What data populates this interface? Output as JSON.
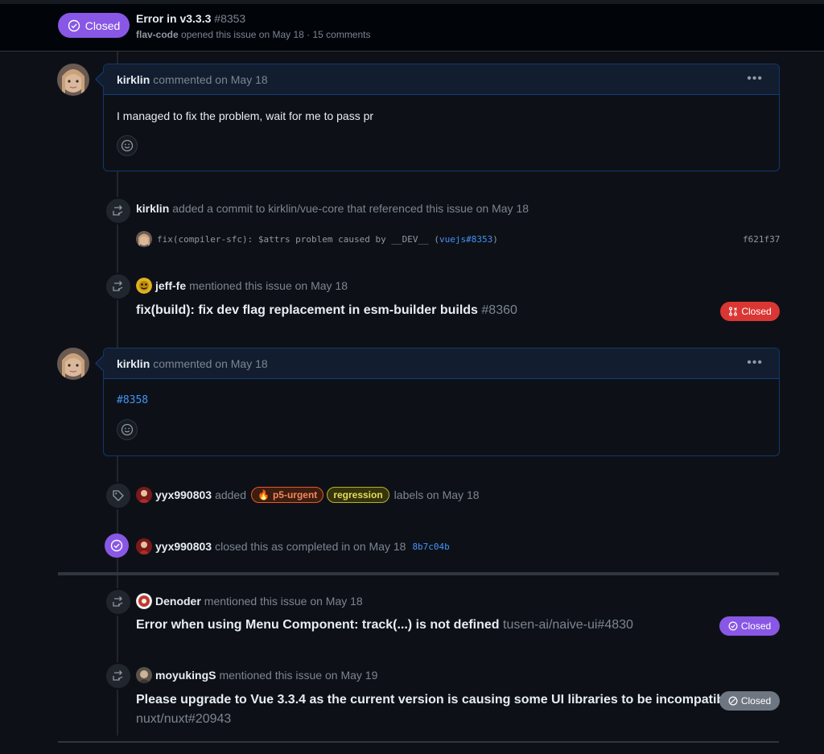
{
  "header": {
    "state": "Closed",
    "title": "Error in v3.3.3",
    "number": "#8353",
    "author": "flav-code",
    "subtitle": "opened this issue on May 18 · 15 comments"
  },
  "comment1": {
    "author": "kirklin",
    "meta": "commented on May 18",
    "body": "I managed to fix the problem, wait for me to pass pr"
  },
  "commit_event": {
    "actor": "kirklin",
    "text": "added a commit to kirklin/vue-core that referenced this issue on May 18",
    "message": "fix(compiler-sfc): $attrs problem caused by __DEV__ (",
    "ref_link": "vuejs#8353",
    "close_paren": ")",
    "sha": "f621f37"
  },
  "mention1": {
    "actor": "jeff-fe",
    "text": "mentioned this issue on May 18",
    "title": "fix(build): fix dev flag replacement in esm-builder builds",
    "ref": "#8360",
    "state": "Closed"
  },
  "comment2": {
    "author": "kirklin",
    "meta": "commented on May 18",
    "link": "#8358"
  },
  "label_event": {
    "actor": "yyx990803",
    "added": "added",
    "label1": "p5-urgent",
    "label1_emoji": "🔥",
    "label2": "regression",
    "suffix": "labels on May 18"
  },
  "closed_event": {
    "actor": "yyx990803",
    "text": "closed this as completed in on May 18",
    "sha": "8b7c04b"
  },
  "mention2": {
    "actor": "Denoder",
    "text": "mentioned this issue on May 18",
    "title": "Error when using Menu Component: track(...) is not defined",
    "ref": "tusen-ai/naive-ui#4830",
    "state": "Closed"
  },
  "mention3": {
    "actor": "moyukingS",
    "text": "mentioned this issue on May 19",
    "title": "Please upgrade to Vue 3.3.4 as the current version is causing some UI libraries to be incompatible",
    "ref": "nuxt/nuxt#20943",
    "state": "Closed"
  },
  "colors": {
    "closed_purple": "#8957e5",
    "closed_red": "#da3633",
    "closed_gray": "#6e7681",
    "link_blue": "#4493f8",
    "urgent_label": "#e8572c",
    "regression_label": "#b9b02a"
  }
}
